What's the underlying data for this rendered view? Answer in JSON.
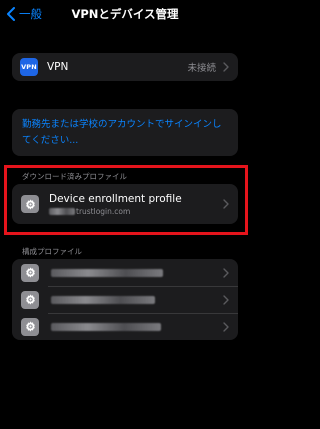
{
  "nav": {
    "back_label": "一般",
    "title": "VPNとデバイス管理"
  },
  "vpn": {
    "icon_text": "VPN",
    "label": "VPN",
    "status": "未接続"
  },
  "signin": {
    "text": "勤務先または学校のアカウントでサインインしてください..."
  },
  "downloaded_section": {
    "header": "ダウンロード済みプロファイル",
    "item": {
      "title": "Device enrollment profile",
      "subtitle_visible": "trustlogin.com"
    }
  },
  "config_section": {
    "header": "構成プロファイル",
    "item_count_note": "3 profiles with obscured names"
  },
  "colors": {
    "accent": "#0a84ff",
    "background": "#000000",
    "cell": "#1c1c1e",
    "secondary_text": "#8e8e93",
    "vpn_icon": "#1e66e6",
    "highlight": "#e5141c"
  },
  "icons": {
    "back": "chevron-left-icon",
    "row_chevron": "chevron-right-icon",
    "profile": "gear-icon"
  }
}
